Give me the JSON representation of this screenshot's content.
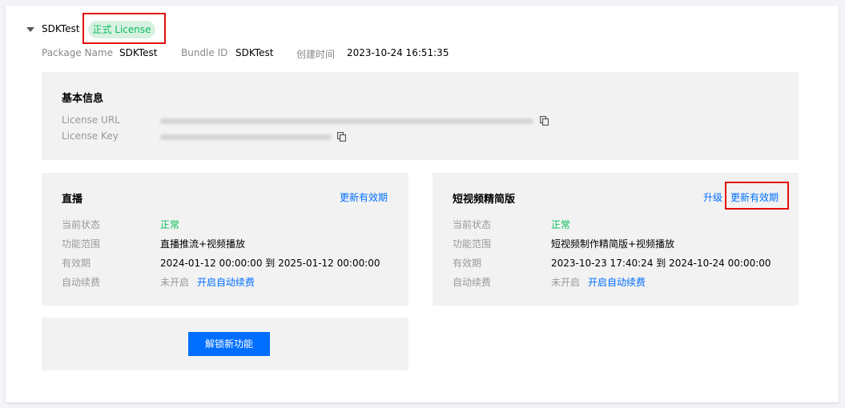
{
  "header": {
    "app_name": "SDKTest",
    "license_tag": "正式 License",
    "meta": [
      {
        "label": "Package Name",
        "value": "SDKTest"
      },
      {
        "label": "Bundle ID",
        "value": "SDKTest"
      },
      {
        "label": "创建时间",
        "value": "2023-10-24 16:51:35"
      }
    ]
  },
  "basic_info": {
    "title": "基本信息",
    "rows": [
      {
        "label": "License URL"
      },
      {
        "label": "License Key"
      }
    ]
  },
  "live": {
    "title": "直播",
    "renew_link": "更新有效期",
    "rows": [
      {
        "label": "当前状态",
        "value": "正常"
      },
      {
        "label": "功能范围",
        "value": "直播推流+视频播放"
      },
      {
        "label": "有效期",
        "value": "2024-01-12 00:00:00 到 2025-01-12 00:00:00"
      },
      {
        "label": "自动续费",
        "value": "未开启",
        "action": "开启自动续费"
      }
    ]
  },
  "short_video": {
    "title": "短视频精简版",
    "upgrade_link": "升级",
    "renew_link": "更新有效期",
    "rows": [
      {
        "label": "当前状态",
        "value": "正常"
      },
      {
        "label": "功能范围",
        "value": "短视频制作精简版+视频播放"
      },
      {
        "label": "有效期",
        "value": "2023-10-23 17:40:24 到 2024-10-24 00:00:00"
      },
      {
        "label": "自动续费",
        "value": "未开启",
        "action": "开启自动续费"
      }
    ]
  },
  "unlock": {
    "button_label": "解锁新功能"
  },
  "colors": {
    "accent": "#006eff",
    "success": "#0abf5b",
    "highlight": "#e30b0b",
    "panel_bg": "#f2f2f2"
  }
}
